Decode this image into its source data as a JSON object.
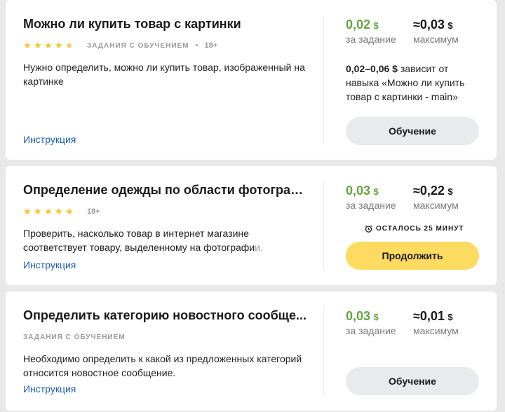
{
  "tasks": [
    {
      "title": "Можно ли купить товар с картинки",
      "rating_stars": 4.5,
      "badge": "Задания с обучением",
      "dot": "•",
      "age": "18+",
      "description": "Нужно определить, можно ли купить товар, изображенный на картинке",
      "instruction_link": "Инструкция",
      "price_per_task": "0,02",
      "price_per_task_label": "за задание",
      "price_max_prefix": "≈",
      "price_max": "0,03",
      "price_max_label": "максимум",
      "currency": "$",
      "skill_range": "0,02–0,06 $",
      "skill_text": " зависит от навыка «Можно ли купить товар с картинки - main»",
      "button_label": "Обучение"
    },
    {
      "title": "Определение одежды по области фотограф...",
      "rating_stars": 5,
      "age": "18+",
      "description_main": "Проверить, насколько товар в интернет магазине соответствует товару, выделенному на фотографи",
      "description_faded": "и.",
      "instruction_link": "Инструкция",
      "price_per_task": "0,03",
      "price_per_task_label": "за задание",
      "price_max_prefix": "≈",
      "price_max": "0,22",
      "price_max_label": "максимум",
      "currency": "$",
      "timer_label": "ОСТАЛОСЬ 25 МИНУТ",
      "button_label": "Продолжить"
    },
    {
      "title": "Определить категорию новостного сообще...",
      "badge": "Задания с обучением",
      "description": "Необходимо определить к какой из предложенных категорий относится новостное сообщение.",
      "instruction_link": "Инструкция",
      "price_per_task": "0,03",
      "price_per_task_label": "за задание",
      "price_max_prefix": "≈",
      "price_max": "0,01",
      "price_max_label": "максимум",
      "currency": "$",
      "button_label": "Обучение"
    }
  ],
  "colors": {
    "price_green": "#65a540",
    "link_blue": "#1d5fb8",
    "star_gold": "#f5c72c",
    "button_yellow": "#fddb60",
    "button_gray": "#e9eaec"
  }
}
